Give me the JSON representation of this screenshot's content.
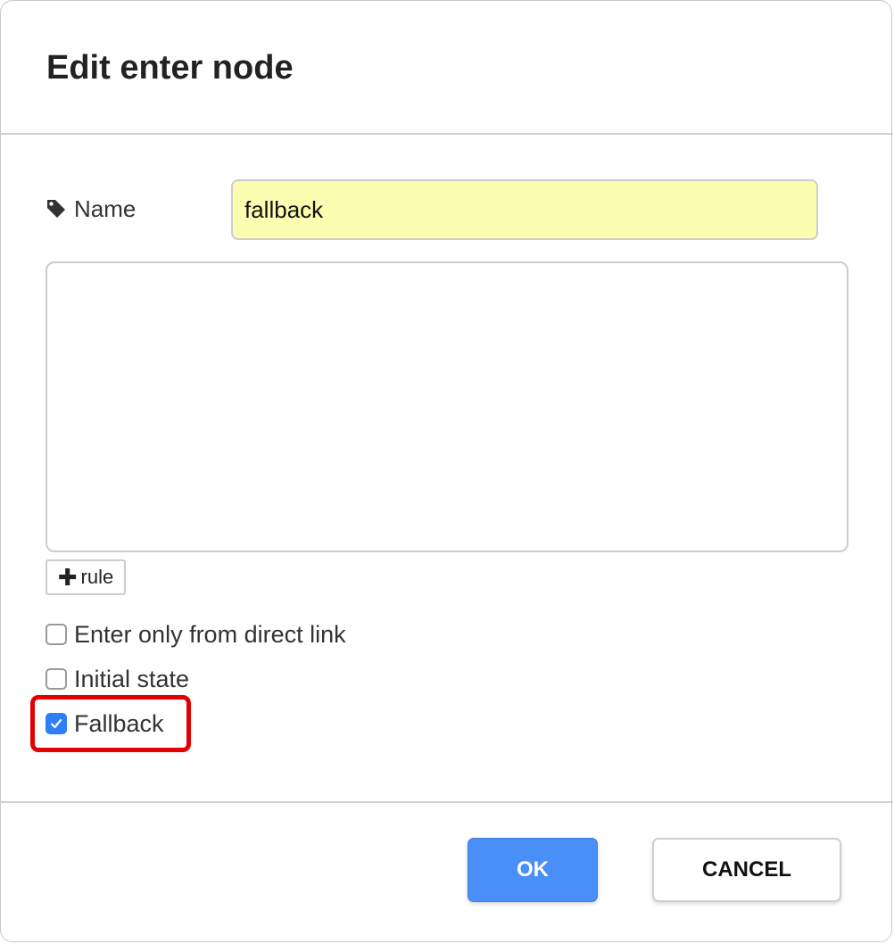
{
  "dialog": {
    "title": "Edit enter node"
  },
  "form": {
    "name_label": "Name",
    "name_icon": "tag-icon",
    "name_value": "fallback",
    "add_rule_label": "rule",
    "add_rule_icon": "plus-icon"
  },
  "options": [
    {
      "label": "Enter only from direct link",
      "checked": false
    },
    {
      "label": "Initial state",
      "checked": false
    },
    {
      "label": "Fallback",
      "checked": true
    }
  ],
  "buttons": {
    "ok_label": "OK",
    "cancel_label": "CANCEL"
  },
  "colors": {
    "input_background": "#fbfdb0",
    "ok_button": "#4a8ef8",
    "checkbox_checked": "#2d7ff9",
    "highlight": "#e40000"
  }
}
